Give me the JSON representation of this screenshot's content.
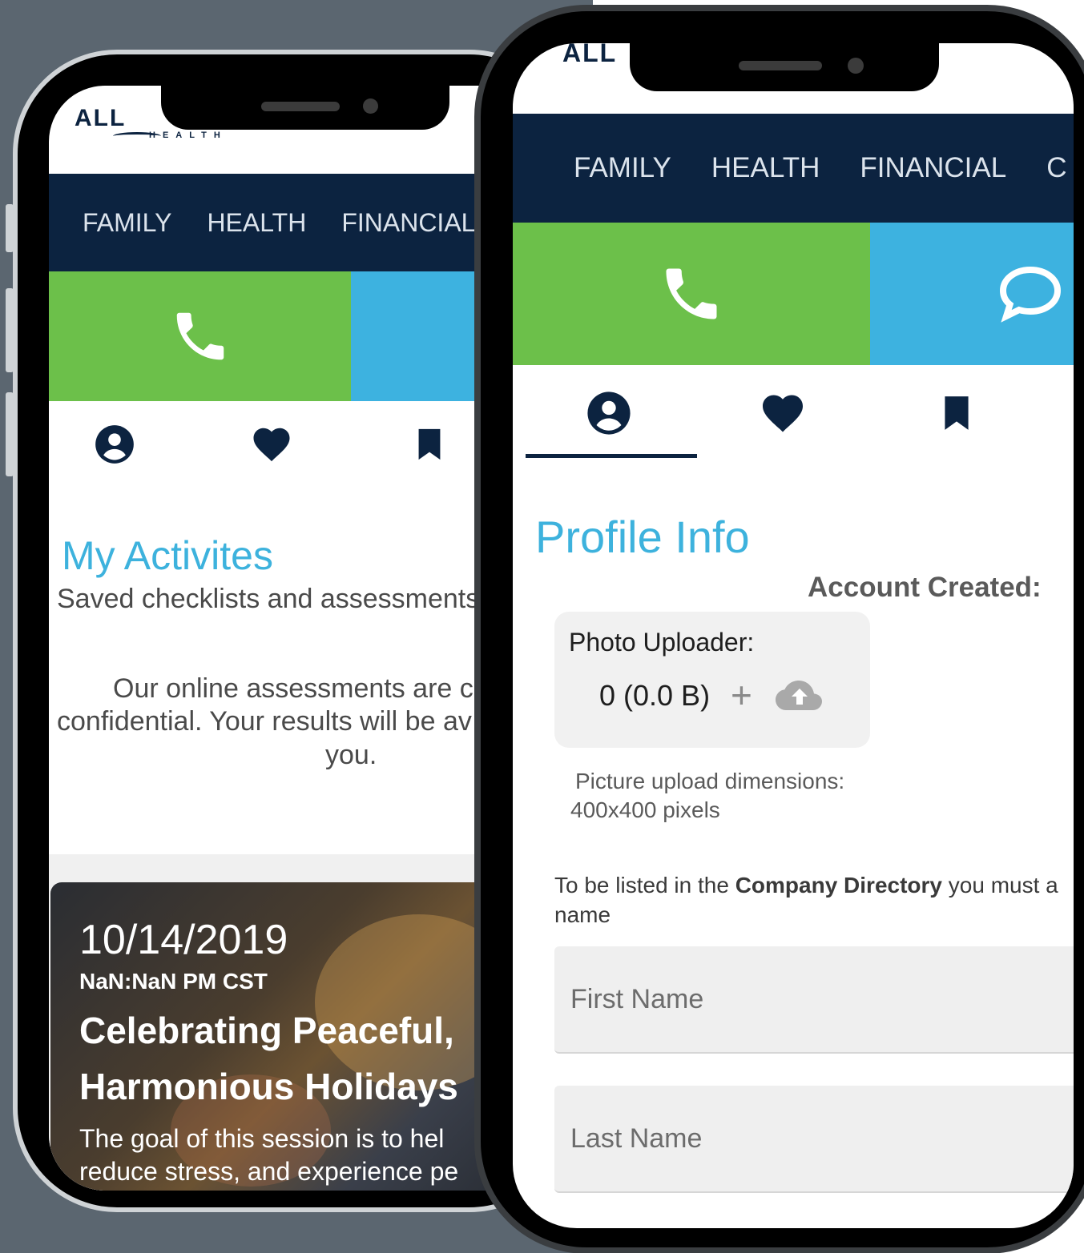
{
  "logo": {
    "text": "ALL",
    "sub": "HEALTH"
  },
  "nav": {
    "family": "FAMILY",
    "health": "HEALTH",
    "financial": "FINANCIAL",
    "more": "C"
  },
  "colors": {
    "navy": "#0c2340",
    "green": "#6cc04a",
    "blue": "#3db2e0",
    "accent": "#3db2dd"
  },
  "left_phone": {
    "activities_title": "My Activites",
    "activities_subtitle": "Saved checklists and assessments",
    "confidential_line1": "Our online assessments are c",
    "confidential_line2": "confidential. Your results will be av",
    "confidential_line3": "you.",
    "event": {
      "date": "10/14/2019",
      "time": "NaN:NaN PM CST",
      "title_line1": "Celebrating Peaceful,",
      "title_line2": "Harmonious Holidays",
      "desc_line1": "The goal of this session is to hel",
      "desc_line2": "reduce stress, and experience pe"
    }
  },
  "right_phone": {
    "profile_title": "Profile Info",
    "account_created": "Account Created:",
    "photo_uploader_label": "Photo Uploader:",
    "photo_count": "0 (0.0 B)",
    "upload_hint_line1": "Picture upload dimensions:",
    "upload_hint_line2": "400x400 pixels",
    "directory_pre": "To be listed in the ",
    "directory_bold": "Company Directory",
    "directory_post": " you must a",
    "directory_line2": "name",
    "first_name_placeholder": "First Name",
    "last_name_placeholder": "Last Name"
  },
  "icons": [
    "phone-icon",
    "chat-icon",
    "user-icon",
    "heart-icon",
    "bookmark-icon",
    "plus-icon",
    "cloud-upload-icon"
  ]
}
